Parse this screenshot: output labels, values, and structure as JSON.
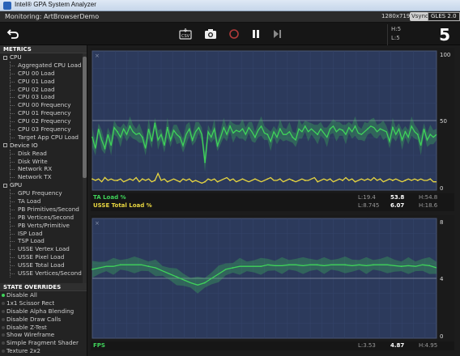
{
  "window": {
    "title": "Intel® GPA System Analyzer"
  },
  "subbar": {
    "monitoring": "Monitoring: ArtBrowserDemo",
    "resolution": "1280x719",
    "vsync": "Vsync",
    "api": "GLES 2.0"
  },
  "toolbar": {
    "hl_top": "H:5",
    "hl_bottom": "L:5",
    "big_value": "5",
    "icons": [
      "back-arrow-icon",
      "csv-export-icon",
      "camera-icon",
      "record-icon",
      "pause-icon",
      "step-icon"
    ]
  },
  "sidebar": {
    "metrics_header": "METRICS",
    "groups": [
      {
        "label": "CPU",
        "items": [
          "Aggregated CPU Load",
          "CPU 00 Load",
          "CPU 01 Load",
          "CPU 02 Load",
          "CPU 03 Load",
          "CPU 00 Frequency",
          "CPU 01 Frequency",
          "CPU 02 Frequency",
          "CPU 03 Frequency",
          "Target App CPU Load"
        ]
      },
      {
        "label": "Device IO",
        "items": [
          "Disk Read",
          "Disk Write",
          "Network RX",
          "Network TX"
        ]
      },
      {
        "label": "GPU",
        "items": [
          "GPU Frequency",
          "TA Load",
          "PB Primitives/Second",
          "PB Vertices/Second",
          "PB Verts/Primitive",
          "ISP Load",
          "TSP Load",
          "USSE Vertex Load",
          "USSE Pixel Load",
          "USSE Total Load",
          "USSE Vertices/Second"
        ]
      }
    ],
    "overrides_header": "STATE OVERRIDES",
    "overrides": [
      {
        "label": "Disable All",
        "active": true
      },
      {
        "label": "1x1 Scissor Rect",
        "active": false
      },
      {
        "label": "Disable Alpha Blending",
        "active": false
      },
      {
        "label": "Disable Draw Calls",
        "active": false
      },
      {
        "label": "Disable Z-Test",
        "active": false
      },
      {
        "label": "Show Wireframe",
        "active": false
      },
      {
        "label": "Simple Fragment Shader",
        "active": false
      },
      {
        "label": "Texture 2x2",
        "active": false
      }
    ]
  },
  "charts": [
    {
      "y_ticks": [
        "100",
        "50",
        "0"
      ],
      "legend": [
        {
          "name": "TA Load %",
          "color": "#3fd35a",
          "low": "L:19.4",
          "current": "53.8",
          "high": "H:54.8"
        },
        {
          "name": "USSE Total Load %",
          "color": "#e8d640",
          "low": "L:8.745",
          "current": "6.07",
          "high": "H:18.6"
        }
      ]
    },
    {
      "y_ticks": [
        "8",
        "4",
        "0"
      ],
      "legend": [
        {
          "name": "FPS",
          "color": "#3fd35a",
          "low": "L:3.53",
          "current": "4.87",
          "high": "H:4.95"
        }
      ]
    }
  ],
  "chart_data": [
    {
      "type": "line",
      "ylim": [
        0,
        100
      ],
      "y_ticks": [
        0,
        50,
        100
      ],
      "series": [
        {
          "name": "TA Load %",
          "color": "#3fd35a",
          "values": [
            38,
            30,
            44,
            36,
            30,
            40,
            32,
            45,
            42,
            38,
            44,
            40,
            46,
            42,
            40,
            41,
            38,
            30,
            44,
            35,
            48,
            36,
            40,
            32,
            45,
            36,
            43,
            40,
            38,
            32,
            40,
            44,
            36,
            42,
            45,
            40,
            20,
            42,
            38,
            44,
            32,
            38,
            45,
            40,
            46,
            41,
            43,
            42,
            44,
            40,
            45,
            42,
            38,
            43,
            46,
            41,
            40,
            35,
            42,
            38,
            44,
            40,
            40,
            42,
            38,
            36,
            44,
            42,
            46,
            42,
            44,
            42,
            40,
            44,
            41,
            38,
            44,
            46,
            42,
            44,
            43,
            40,
            45,
            42,
            46,
            41,
            40,
            42,
            44,
            46,
            45,
            42,
            44,
            43,
            42,
            35,
            45,
            40,
            44,
            36,
            42,
            38,
            46,
            42,
            40,
            32,
            44,
            36,
            40,
            38,
            40
          ]
        },
        {
          "name": "USSE Total Load %",
          "color": "#e8d640",
          "values": [
            8,
            7,
            8,
            6,
            9,
            7,
            8,
            7,
            7,
            8,
            6,
            7,
            8,
            7,
            9,
            6,
            8,
            7,
            8,
            6,
            7,
            12,
            7,
            8,
            6,
            7,
            8,
            7,
            6,
            8,
            7,
            8,
            6,
            7,
            6,
            5,
            6,
            8,
            7,
            8,
            6,
            7,
            8,
            9,
            7,
            8,
            6,
            7,
            8,
            7,
            6,
            7,
            8,
            7,
            6,
            7,
            8,
            9,
            7,
            7,
            8,
            6,
            7,
            8,
            7,
            6,
            7,
            8,
            7,
            7,
            8,
            9,
            6,
            7,
            8,
            7,
            8,
            6,
            7,
            8,
            7,
            9,
            7,
            8,
            6,
            7,
            8,
            7,
            8,
            7,
            9,
            7,
            8,
            6,
            7,
            8,
            7,
            8,
            7,
            6,
            7,
            8,
            7,
            8,
            7,
            8,
            7,
            7,
            8,
            6,
            6
          ]
        }
      ]
    },
    {
      "type": "line",
      "ylim": [
        0,
        8
      ],
      "y_ticks": [
        0,
        4,
        8
      ],
      "series": [
        {
          "name": "FPS",
          "color": "#3fd35a",
          "values": [
            4.6,
            4.7,
            4.8,
            4.8,
            4.9,
            4.9,
            4.9,
            4.9,
            4.8,
            4.7,
            4.5,
            4.3,
            4.1,
            3.9,
            3.7,
            3.55,
            3.7,
            4.0,
            4.3,
            4.6,
            4.7,
            4.8,
            4.8,
            4.8,
            4.8,
            4.9,
            4.85,
            4.85,
            4.9,
            4.9,
            4.85,
            4.9,
            4.9,
            4.85,
            4.9,
            4.9,
            4.9,
            4.85,
            4.9,
            4.85,
            4.9,
            4.9,
            4.9,
            4.85,
            4.8,
            4.85,
            4.8,
            4.9,
            4.85,
            4.7
          ]
        }
      ]
    }
  ]
}
